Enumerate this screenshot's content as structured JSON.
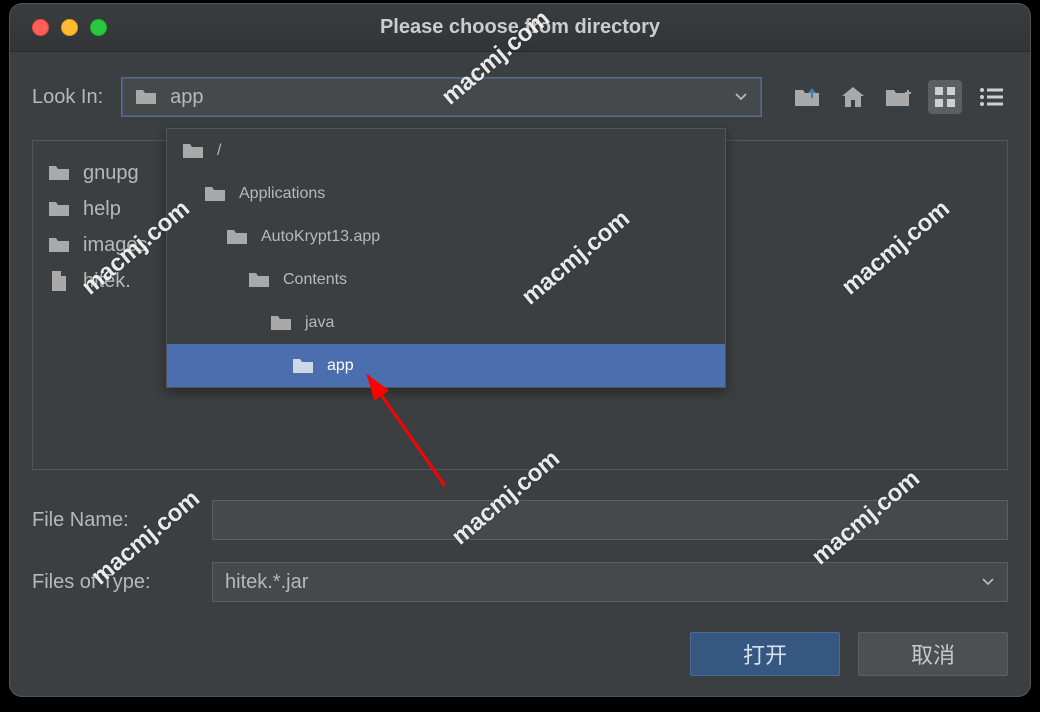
{
  "title": "Please choose from directory",
  "lookin": {
    "label": "Look In:",
    "value": "app"
  },
  "dropdown": {
    "items": [
      {
        "label": "/",
        "indent": 0,
        "selected": false
      },
      {
        "label": "Applications",
        "indent": 1,
        "selected": false
      },
      {
        "label": "AutoKrypt13.app",
        "indent": 2,
        "selected": false
      },
      {
        "label": "Contents",
        "indent": 3,
        "selected": false
      },
      {
        "label": "java",
        "indent": 4,
        "selected": false
      },
      {
        "label": "app",
        "indent": 5,
        "selected": true
      }
    ]
  },
  "files": [
    {
      "name": "gnupg",
      "type": "folder"
    },
    {
      "name": "help",
      "type": "folder"
    },
    {
      "name": "images",
      "type": "folder"
    },
    {
      "name": "hitek.",
      "type": "file"
    }
  ],
  "form": {
    "filename_label": "File Name:",
    "filename_value": "",
    "filetype_label": "Files of Type:",
    "filetype_value": "hitek.*.jar"
  },
  "buttons": {
    "open": "打开",
    "cancel": "取消"
  },
  "watermark_text": "macmj.com"
}
